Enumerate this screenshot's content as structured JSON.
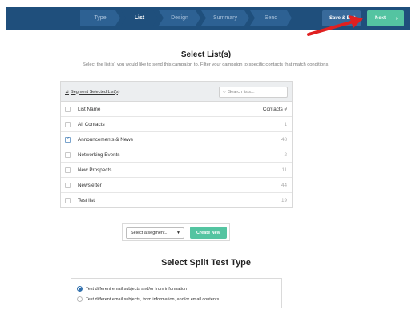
{
  "nav": {
    "steps": [
      "Type",
      "List",
      "Design",
      "Summary",
      "Send"
    ],
    "active_step": "List",
    "save_label": "Save & Exit",
    "next_label": "Next",
    "next_chevron": "›"
  },
  "lists_section": {
    "title": "Select List(s)",
    "subtitle": "Select the list(s) you would like to send this campaign to. Filter your campaign to specific contacts that match conditions.",
    "segment_link": "Segment Selected List(s)",
    "search_placeholder": "Search lists...",
    "col_name": "List Name",
    "col_count": "Contacts #",
    "rows": [
      {
        "name": "All Contacts",
        "count": "1",
        "checked": false
      },
      {
        "name": "Announcements & News",
        "count": "48",
        "checked": true
      },
      {
        "name": "Networking Events",
        "count": "2",
        "checked": false
      },
      {
        "name": "New Prospects",
        "count": "11",
        "checked": false
      },
      {
        "name": "Newsletter",
        "count": "44",
        "checked": false
      },
      {
        "name": "Test list",
        "count": "19",
        "checked": false
      }
    ]
  },
  "segment": {
    "select_label": "Select a segment...",
    "create_label": "Create New"
  },
  "split_test": {
    "title": "Select Split Test Type",
    "options": [
      {
        "label": "Test different email subjects and/or from information",
        "selected": true
      },
      {
        "label": "Test different email subjects, from information, and/or email contents.",
        "selected": false
      }
    ]
  },
  "colors": {
    "nav_bg": "#1f4f7c",
    "accent_green": "#54c4a1",
    "arrow_red": "#e02020"
  }
}
